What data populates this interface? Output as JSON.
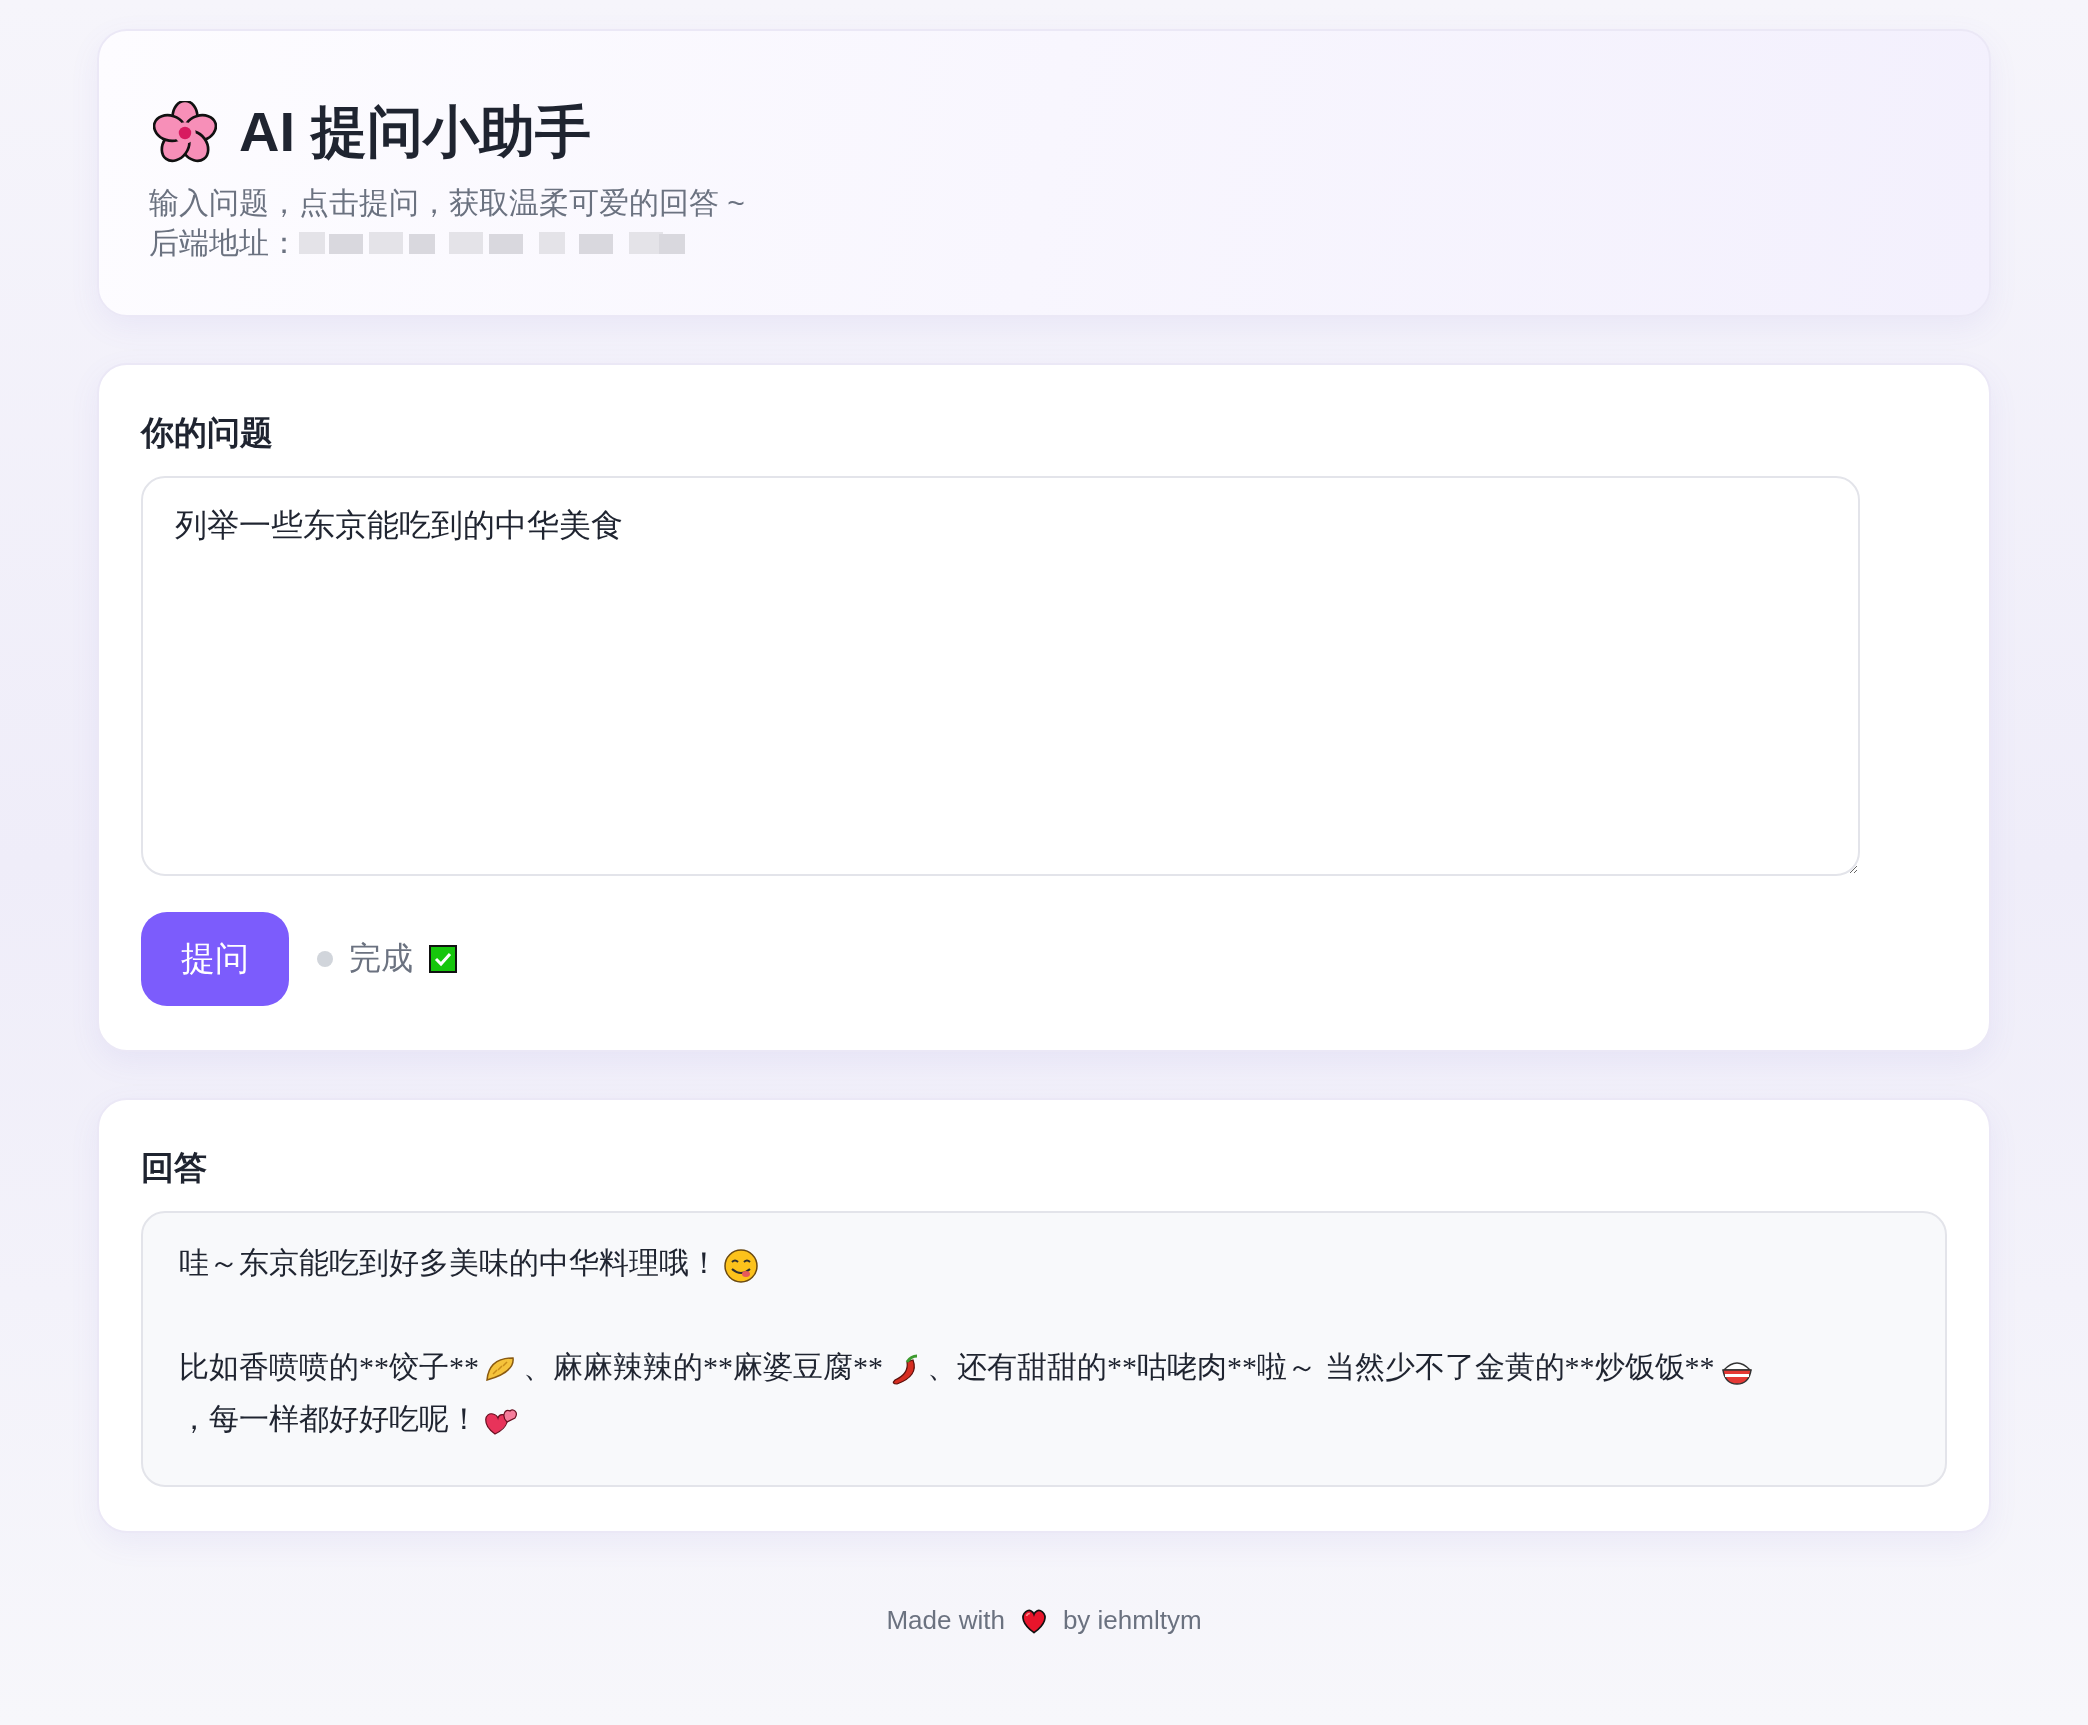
{
  "header": {
    "title": "AI 提问小助手",
    "subtitle": "输入问题，点击提问，获取温柔可爱的回答 ~",
    "backend_label": "后端地址："
  },
  "question": {
    "heading": "你的问题",
    "value": "列举一些东京能吃到的中华美食"
  },
  "ask_button": "提问",
  "status": {
    "text": "完成",
    "done": true
  },
  "answer": {
    "heading": "回答",
    "paragraphs": [
      [
        {
          "kind": "text",
          "text": "哇～东京能吃到好多美味的中华料理哦！"
        },
        {
          "kind": "icon"
        }
      ],
      [
        {
          "kind": "text",
          "text": "比如香喷喷的**饺子**"
        },
        {
          "kind": "icon"
        },
        {
          "kind": "text",
          "text": "、麻麻辣辣的**麻婆豆腐**"
        },
        {
          "kind": "icon"
        },
        {
          "kind": "text",
          "text": "、还有甜甜的**咕咾肉**啦～ 当然少不了金黄的**炒饭饭**"
        },
        {
          "kind": "icon"
        },
        {
          "kind": "text",
          "text": "，每一样都好好吃呢！"
        },
        {
          "kind": "icon"
        }
      ]
    ]
  },
  "footer": {
    "before": "Made with",
    "after": "by iehmltym"
  }
}
